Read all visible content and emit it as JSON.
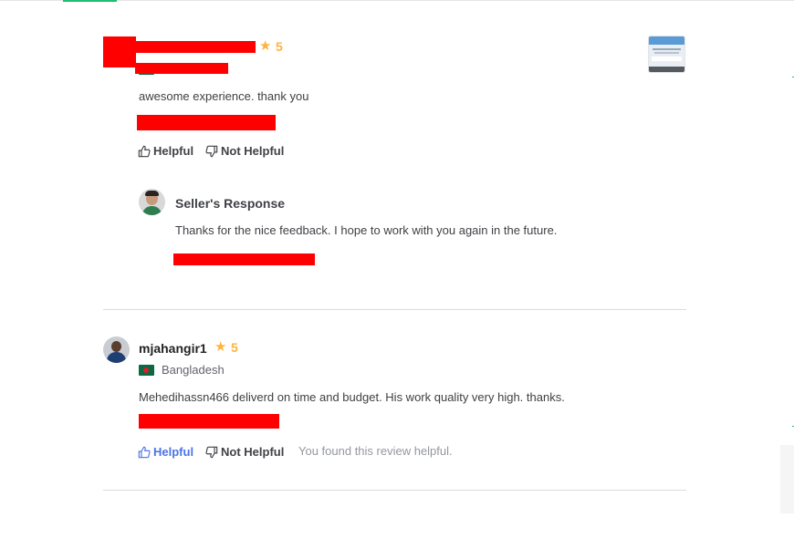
{
  "review1": {
    "rating": "5",
    "comment": "awesome experience. thank you",
    "helpful_label": "Helpful",
    "not_helpful_label": "Not Helpful",
    "response": {
      "title": "Seller's Response",
      "text": "Thanks for the nice feedback. I hope to work with you again in the future."
    }
  },
  "review2": {
    "username": "mjahangir1",
    "rating": "5",
    "country": "Bangladesh",
    "comment": "Mehedihassn466 deliverd on time and budget. His work quality very high. thanks.",
    "helpful_label": "Helpful",
    "not_helpful_label": "Not Helpful",
    "feedback_note": "You found this review helpful."
  },
  "colors": {
    "accent_green": "#1dbf73",
    "star": "#ffb33e",
    "link_blue": "#4a73e8",
    "redaction": "#ff0000"
  },
  "icons": [
    "star-icon",
    "thumbs-up-icon",
    "thumbs-down-icon",
    "bangladesh-flag-icon"
  ]
}
